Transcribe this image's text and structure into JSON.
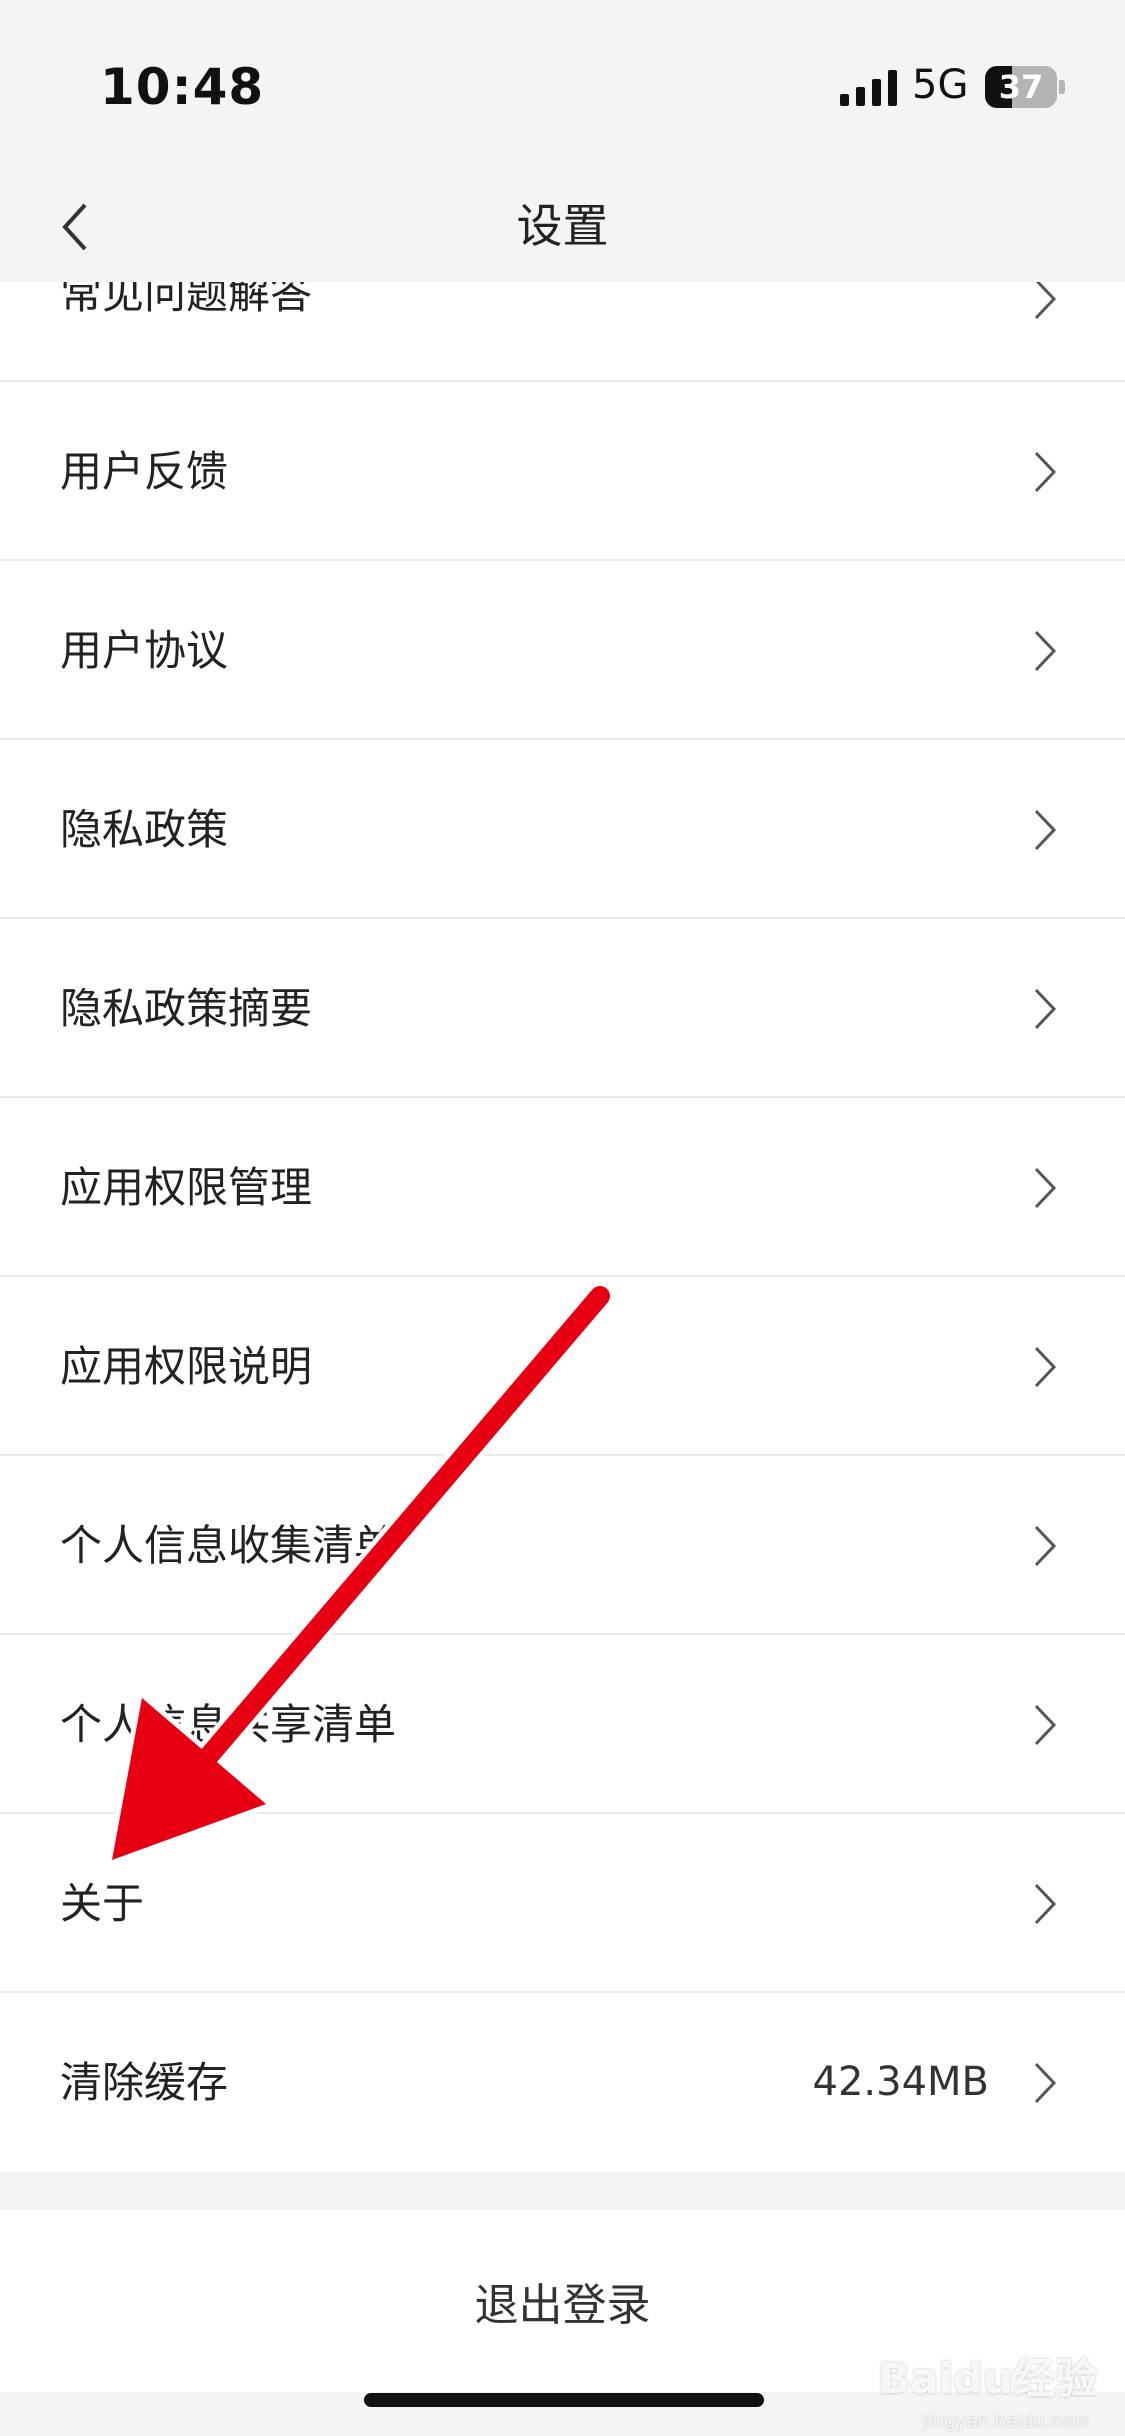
{
  "status_bar": {
    "time": "10:48",
    "network": "5G",
    "battery": "37",
    "battery_level": 0.37
  },
  "nav": {
    "title": "设置"
  },
  "rows": [
    {
      "label": "常见问题解答"
    },
    {
      "label": "用户反馈"
    },
    {
      "label": "用户协议"
    },
    {
      "label": "隐私政策"
    },
    {
      "label": "隐私政策摘要"
    },
    {
      "label": "应用权限管理"
    },
    {
      "label": "应用权限说明"
    },
    {
      "label": "个人信息收集清单"
    },
    {
      "label": "个人信息共享清单"
    },
    {
      "label": "关于"
    },
    {
      "label": "清除缓存",
      "value": "42.34MB"
    }
  ],
  "logout": {
    "label": "退出登录"
  },
  "watermark": {
    "text": "Baidu经验",
    "url": "jingyan.baidu.com"
  },
  "colors": {
    "arrow": "#e60012",
    "background": "#f4f4f4",
    "divider": "#eaeaea"
  }
}
